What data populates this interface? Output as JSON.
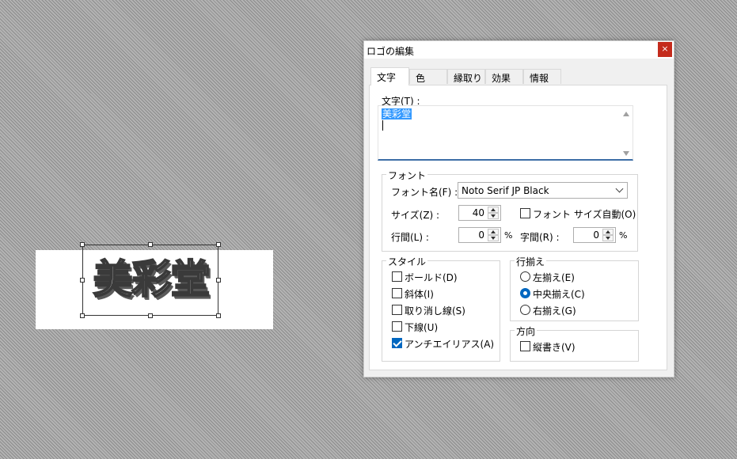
{
  "canvas": {
    "logo_text": "美彩堂"
  },
  "dialog": {
    "title": "ロゴの編集",
    "close_glyph": "×",
    "tabs": [
      {
        "label": "文字",
        "active": true
      },
      {
        "label": "色",
        "active": false
      },
      {
        "label": "縁取り",
        "active": false
      },
      {
        "label": "効果",
        "active": false
      },
      {
        "label": "情報",
        "active": false
      }
    ],
    "text_label": "文字(T) :",
    "text_value": "美彩堂",
    "font_group": {
      "title": "フォント",
      "font_name_label": "フォント名(F) :",
      "font_name_value": "Noto Serif JP Black",
      "size_label": "サイズ(Z) :",
      "size_value": "40",
      "auto_size_label": "フォント サイズ自動(O)",
      "auto_size_checked": false,
      "line_spacing_label": "行間(L) :",
      "line_spacing_value": "0",
      "line_spacing_unit": "%",
      "char_spacing_label": "字間(R) :",
      "char_spacing_value": "0",
      "char_spacing_unit": "%"
    },
    "style_group": {
      "title": "スタイル",
      "items": [
        {
          "label": "ボールド(D)",
          "checked": false
        },
        {
          "label": "斜体(I)",
          "checked": false
        },
        {
          "label": "取り消し線(S)",
          "checked": false
        },
        {
          "label": "下線(U)",
          "checked": false
        },
        {
          "label": "アンチエイリアス(A)",
          "checked": true
        }
      ]
    },
    "align_group": {
      "title": "行揃え",
      "items": [
        {
          "label": "左揃え(E)",
          "selected": false
        },
        {
          "label": "中央揃え(C)",
          "selected": true
        },
        {
          "label": "右揃え(G)",
          "selected": false
        }
      ]
    },
    "direction_group": {
      "title": "方向",
      "vertical_label": "縦書き(V)",
      "vertical_checked": false
    }
  },
  "colors": {
    "accent": "#0067c0",
    "close_button": "#c42b1c",
    "selection": "#3399ff"
  }
}
